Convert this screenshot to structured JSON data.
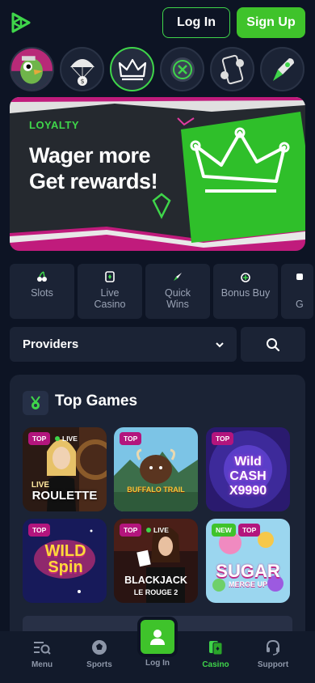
{
  "header": {
    "login_label": "Log In",
    "signup_label": "Sign Up",
    "brand_color": "#3fc32b"
  },
  "stories": [
    {
      "icon": "parrot-character-icon"
    },
    {
      "icon": "parachute-coin-icon"
    },
    {
      "icon": "crown-icon",
      "active": true
    },
    {
      "icon": "chip-coin-icon"
    },
    {
      "icon": "phone-chat-icon"
    },
    {
      "icon": "rocket-icon"
    }
  ],
  "banner": {
    "tag": "LOYALTY",
    "title_line1": "Wager more",
    "title_line2": "Get rewards!"
  },
  "categories": [
    {
      "label": "Slots",
      "icon": "cherries-icon"
    },
    {
      "label": "Live Casino",
      "icon": "playing-card-icon"
    },
    {
      "label": "Quick Wins",
      "icon": "rocket-icon"
    },
    {
      "label": "Bonus Buy",
      "icon": "bonus-plus-icon"
    },
    {
      "label": "G",
      "icon": "game-icon"
    }
  ],
  "providers": {
    "label": "Providers"
  },
  "top_games": {
    "title": "Top Games",
    "games": [
      {
        "name": "ROULETTE",
        "prefix": "LIVE",
        "badge": "TOP",
        "live": "LIVE"
      },
      {
        "name": "BUFFALO TRAIL",
        "badge": "TOP"
      },
      {
        "name": "Wild CASH X9990",
        "badge": "TOP"
      },
      {
        "name": "WILD Spin",
        "badge": "TOP"
      },
      {
        "name": "BLACKJACK",
        "sub": "LE ROUGE 2",
        "badge": "TOP",
        "live": "LIVE"
      },
      {
        "name": "SUGAR",
        "sub": "MERGE UP",
        "badge_new": "NEW",
        "badge": "TOP"
      }
    ]
  },
  "bottom_nav": {
    "menu": "Menu",
    "sports": "Sports",
    "login": "Log In",
    "casino": "Casino",
    "support": "Support"
  }
}
